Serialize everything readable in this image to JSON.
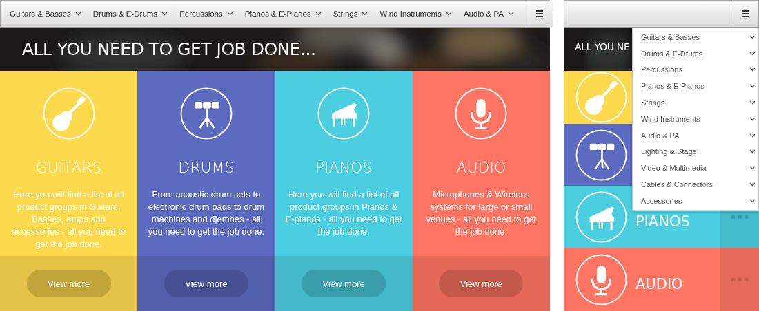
{
  "desktop": {
    "nav": [
      "Guitars & Basses",
      "Drums & E-Drums",
      "Percussions",
      "Pianos & E-Pianos",
      "Strings",
      "Wind Instruments",
      "Audio & PA"
    ],
    "hero": {
      "title": "ALL YOU NEED TO GET JOB DONE..."
    },
    "categories": [
      {
        "kind": "guitar",
        "title": "GUITARS",
        "description": "Here you will find a list of all product groups in Guitars, Basses, amps and accessories - all you need to get the job done.",
        "button": "View more",
        "color": "#fdd94e"
      },
      {
        "kind": "drums",
        "title": "DRUMS",
        "description": "From acoustic drum sets to electronic drum pads to drum machines and djembes - all you need to get the job done.",
        "button": "View more",
        "color": "#5c6bc0"
      },
      {
        "kind": "piano",
        "title": "PIANOS",
        "description": "Here you will find a list of all product groups in Pianos & E-pianos - all you need to get the job done.",
        "button": "View more",
        "color": "#4bcfe0"
      },
      {
        "kind": "microphone",
        "title": "AUDIO",
        "description": "Microphones & Wireless systems for large or small venues - all you need to get the job done.",
        "button": "View more",
        "color": "#fe7563"
      }
    ]
  },
  "mobile": {
    "hero": {
      "title": "ALL YOU NE"
    },
    "rows": [
      {
        "kind": "guitar",
        "color": "#fdd94e"
      },
      {
        "kind": "drums",
        "color": "#5c6bc0"
      },
      {
        "kind": "piano",
        "title": "PIANOS",
        "color": "#4bcfe0"
      },
      {
        "kind": "microphone",
        "title": "AUDIO",
        "color": "#fe7563"
      }
    ],
    "menu": {
      "expanded": true,
      "items": [
        "Guitars & Basses",
        "Drums & E-Drums",
        "Percussions",
        "Pianos & E-Pianos",
        "Strings",
        "Wind Instruments",
        "Audio & PA",
        "Lighting & Stage",
        "Video & Multimedia",
        "Cables & Connectors",
        "Accessories"
      ]
    }
  }
}
